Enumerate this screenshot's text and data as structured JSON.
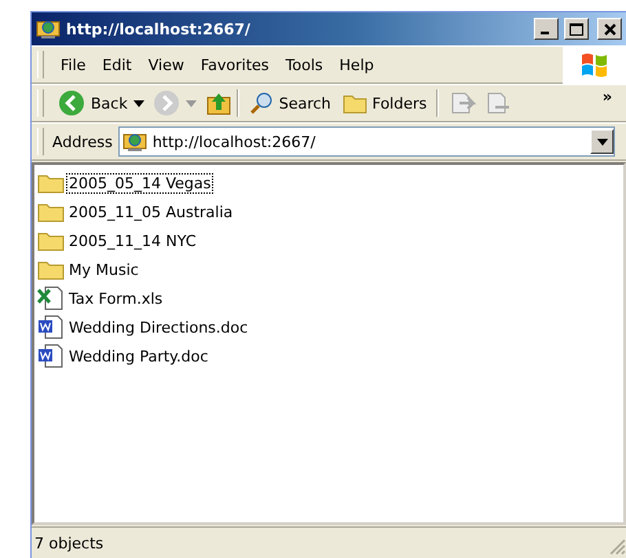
{
  "window": {
    "title": "http://localhost:2667/"
  },
  "menu": [
    "File",
    "Edit",
    "View",
    "Favorites",
    "Tools",
    "Help"
  ],
  "toolbar": {
    "back": "Back",
    "search": "Search",
    "folders": "Folders",
    "more": "»"
  },
  "address": {
    "label": "Address",
    "value": "http://localhost:2667/"
  },
  "files": [
    {
      "name": "2005_05_14 Vegas",
      "kind": "folder",
      "focused": true
    },
    {
      "name": "2005_11_05 Australia",
      "kind": "folder",
      "focused": false
    },
    {
      "name": "2005_11_14 NYC",
      "kind": "folder",
      "focused": false
    },
    {
      "name": "My Music",
      "kind": "folder",
      "focused": false
    },
    {
      "name": "Tax Form.xls",
      "kind": "excel",
      "focused": false
    },
    {
      "name": "Wedding Directions.doc",
      "kind": "word",
      "focused": false
    },
    {
      "name": "Wedding Party.doc",
      "kind": "word",
      "focused": false
    }
  ],
  "status_bar": "7 objects"
}
